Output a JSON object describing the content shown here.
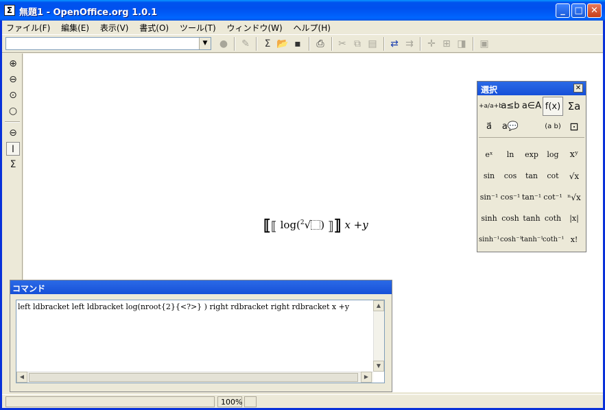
{
  "window": {
    "title": "無題1 - OpenOffice.org 1.0.1",
    "app_icon": "Σ",
    "controls": {
      "minimize": "_",
      "maximize": "□",
      "close": "✕"
    }
  },
  "menu": {
    "items": [
      "ファイル(F)",
      "編集(E)",
      "表示(V)",
      "書式(O)",
      "ツール(T)",
      "ウィンドウ(W)",
      "ヘルプ(H)"
    ]
  },
  "toolbar": {
    "url_value": "",
    "icons": [
      "load-url",
      "edit-file",
      "formula-cursor",
      "open",
      "save",
      "print",
      "cut",
      "copy",
      "paste",
      "undo-redo",
      "redo",
      "cross",
      "gallery",
      "navigator",
      "image"
    ]
  },
  "left_toolbar": {
    "icons": [
      "zoom-in",
      "zoom-out",
      "zoom-100",
      "zoom-page",
      "zoom-all",
      "formula-cursor",
      "symbols"
    ]
  },
  "document": {
    "formula_prefix": "log(",
    "formula_root_index": "2",
    "formula_suffix": ")",
    "formula_after": "x +y"
  },
  "palette": {
    "title": "選択",
    "close_label": "✕",
    "categories": [
      "+a/a+b",
      "a≤b",
      "a∈A",
      "f(x)",
      "Σa",
      "a⃗",
      "a💬",
      "",
      "(a b)",
      "⊡"
    ],
    "functions": [
      [
        "eˣ",
        "ln",
        "exp",
        "log",
        "xʸ"
      ],
      [
        "sin",
        "cos",
        "tan",
        "cot",
        "√x"
      ],
      [
        "sin⁻¹",
        "cos⁻¹",
        "tan⁻¹",
        "cot⁻¹",
        "ⁿ√x"
      ],
      [
        "sinh",
        "cosh",
        "tanh",
        "coth",
        "|x|"
      ],
      [
        "sinh⁻¹",
        "cosh⁻¹",
        "tanh⁻¹",
        "coth⁻¹",
        "x!"
      ]
    ]
  },
  "command": {
    "title": "コマンド",
    "text": "left ldbracket left ldbracket log(nroot{2}{<?>} ) right rdbracket  right rdbracket x  +y"
  },
  "status": {
    "zoom": "100%"
  }
}
